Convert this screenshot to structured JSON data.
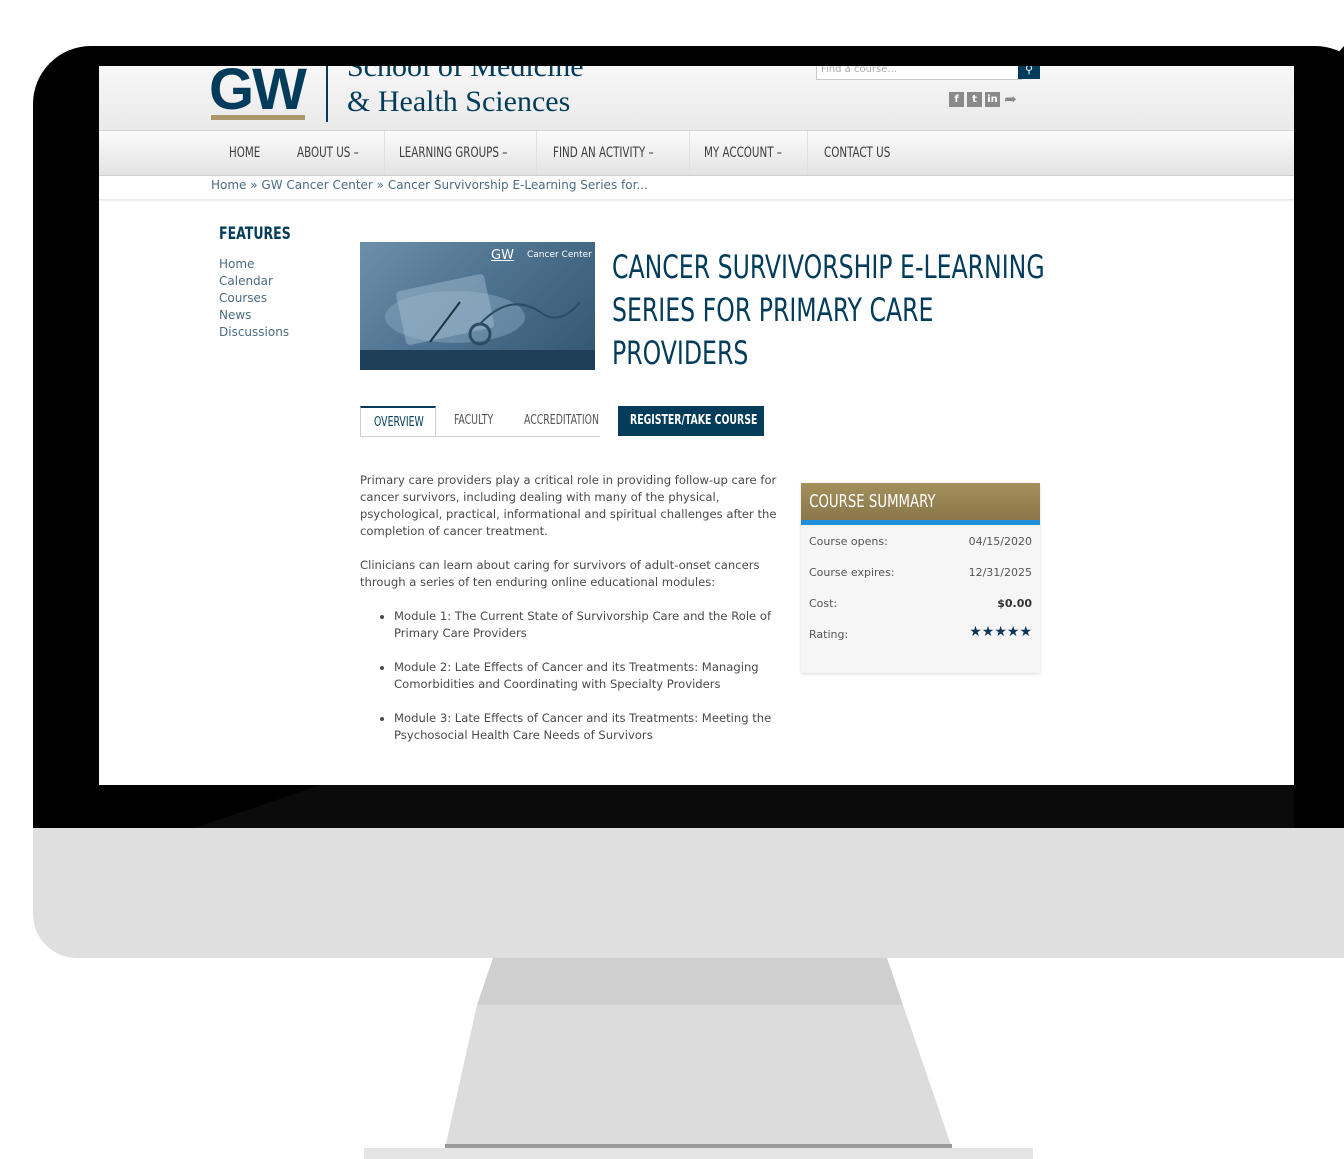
{
  "header": {
    "logo": "GW",
    "school_line_1": "School of Medicine",
    "school_line_2": "& Health Sciences",
    "search_placeholder": "Find a course...",
    "social_icons": [
      "facebook-icon",
      "twitter-icon",
      "linkedin-icon",
      "share-icon"
    ]
  },
  "nav": {
    "items": [
      {
        "label": "HOME"
      },
      {
        "label": "ABOUT US",
        "has_dropdown": true
      },
      {
        "label": "LEARNING GROUPS",
        "has_dropdown": true
      },
      {
        "label": "FIND AN ACTIVITY",
        "has_dropdown": true
      },
      {
        "label": "MY ACCOUNT",
        "has_dropdown": true
      },
      {
        "label": "CONTACT US"
      }
    ]
  },
  "breadcrumb": "Home » GW Cancer Center » Cancer Survivorship E-Learning Series for...",
  "features": {
    "title": "FEATURES",
    "items": [
      "Home",
      "Calendar",
      "Courses",
      "News",
      "Discussions"
    ]
  },
  "course": {
    "image_logo": "GW",
    "image_caption": "Cancer Center",
    "title_lines": [
      "CANCER SURVIVORSHIP E-LEARNING",
      "SERIES FOR PRIMARY CARE",
      "PROVIDERS"
    ]
  },
  "tabs": {
    "overview": "OVERVIEW",
    "faculty": "FACULTY",
    "accreditation": "ACCREDITATION",
    "register": "REGISTER/TAKE COURSE"
  },
  "description": {
    "paragraph_1": "Primary care providers play a critical role in providing follow-up care for cancer survivors, including dealing with many of the physical, psychological, practical, informational and spiritual challenges after the completion of cancer treatment.",
    "paragraph_2": "Clinicians can learn about caring for survivors of adult-onset cancers through a series of ten enduring online educational modules:",
    "modules": [
      "Module 1: The Current State of Survivorship Care and the Role of Primary Care Providers",
      "Module 2: Late Effects of Cancer and its Treatments: Managing Comorbidities and Coordinating with Specialty Providers",
      "Module 3: Late Effects of Cancer and its Treatments: Meeting the Psychosocial Health Care Needs of Survivors"
    ]
  },
  "summary": {
    "title": "COURSE SUMMARY",
    "opens_label": "Course opens:",
    "opens_value": "04/15/2020",
    "expires_label": "Course expires:",
    "expires_value": "12/31/2025",
    "cost_label": "Cost:",
    "cost_value": "$0.00",
    "rating_label": "Rating:",
    "rating_value": 5,
    "rating_stars": "★★★★★"
  },
  "colors": {
    "brand_navy": "#033c5a",
    "brand_gold": "#aa9868",
    "summary_accent": "#1e8fd8"
  }
}
